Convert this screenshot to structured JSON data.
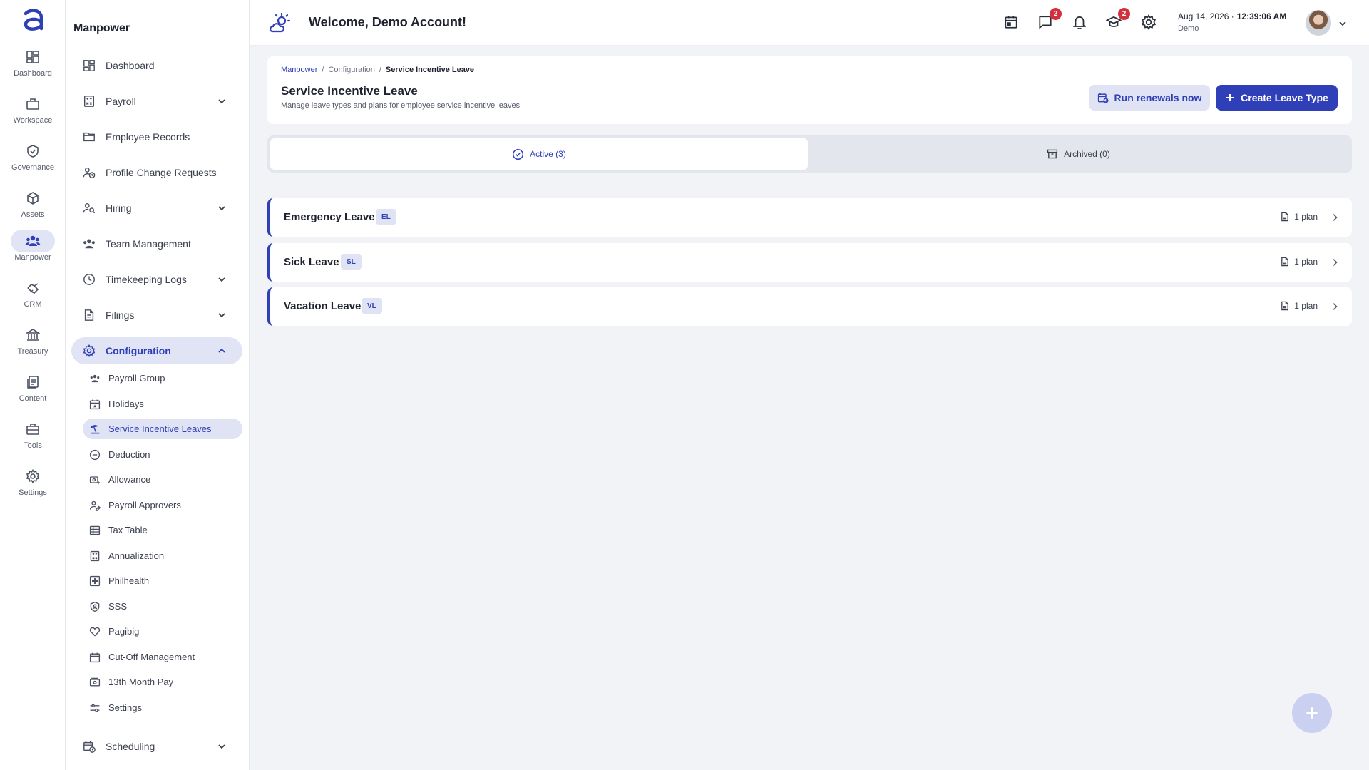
{
  "rail": {
    "items": [
      {
        "label": "Dashboard",
        "icon": "dashboard-icon"
      },
      {
        "label": "Workspace",
        "icon": "briefcase-icon"
      },
      {
        "label": "Governance",
        "icon": "shield-check-icon"
      },
      {
        "label": "Assets",
        "icon": "cube-icon"
      },
      {
        "label": "Manpower",
        "icon": "people-icon"
      },
      {
        "label": "CRM",
        "icon": "handshake-icon"
      },
      {
        "label": "Treasury",
        "icon": "bank-icon"
      },
      {
        "label": "Content",
        "icon": "documents-icon"
      },
      {
        "label": "Tools",
        "icon": "toolbox-icon"
      },
      {
        "label": "Settings",
        "icon": "gear-icon"
      }
    ]
  },
  "sidebar": {
    "title": "Manpower",
    "items": [
      {
        "label": "Dashboard"
      },
      {
        "label": "Payroll"
      },
      {
        "label": "Employee Records"
      },
      {
        "label": "Profile Change Requests"
      },
      {
        "label": "Hiring"
      },
      {
        "label": "Team Management"
      },
      {
        "label": "Timekeeping Logs"
      },
      {
        "label": "Filings"
      },
      {
        "label": "Configuration"
      },
      {
        "label": "Scheduling"
      }
    ],
    "config_items": [
      {
        "label": "Payroll Group"
      },
      {
        "label": "Holidays"
      },
      {
        "label": "Service Incentive Leaves"
      },
      {
        "label": "Deduction"
      },
      {
        "label": "Allowance"
      },
      {
        "label": "Payroll Approvers"
      },
      {
        "label": "Tax Table"
      },
      {
        "label": "Annualization"
      },
      {
        "label": "Philhealth"
      },
      {
        "label": "SSS"
      },
      {
        "label": "Pagibig"
      },
      {
        "label": "Cut-Off Management"
      },
      {
        "label": "13th Month Pay"
      },
      {
        "label": "Settings"
      }
    ]
  },
  "header": {
    "welcome": "Welcome, Demo Account!",
    "messages_badge": "2",
    "courses_badge": "2",
    "date": "Aug 14, 2026 ·",
    "time": "12:39:06 AM",
    "user": "Demo"
  },
  "page": {
    "breadcrumb": [
      "Manpower",
      "/",
      "Configuration",
      "/",
      "Service Incentive Leave"
    ],
    "title": "Service Incentive Leave",
    "subtitle": "Manage leave types and plans for employee service incentive leaves",
    "renew_label": "Run renewals now",
    "create_label": "Create Leave Type"
  },
  "tabs": {
    "active": "Active (3)",
    "archived": "Archived (0)"
  },
  "leave_types": [
    {
      "name": "Emergency Leave",
      "code": "EL",
      "plans": "1 plan"
    },
    {
      "name": "Sick Leave",
      "code": "SL",
      "plans": "1 plan"
    },
    {
      "name": "Vacation Leave",
      "code": "VL",
      "plans": "1 plan"
    }
  ],
  "colors": {
    "accent": "#2f3fb8",
    "accent_soft": "#dfe3f3",
    "badge": "#d32f3c",
    "background": "#f2f3f7"
  }
}
